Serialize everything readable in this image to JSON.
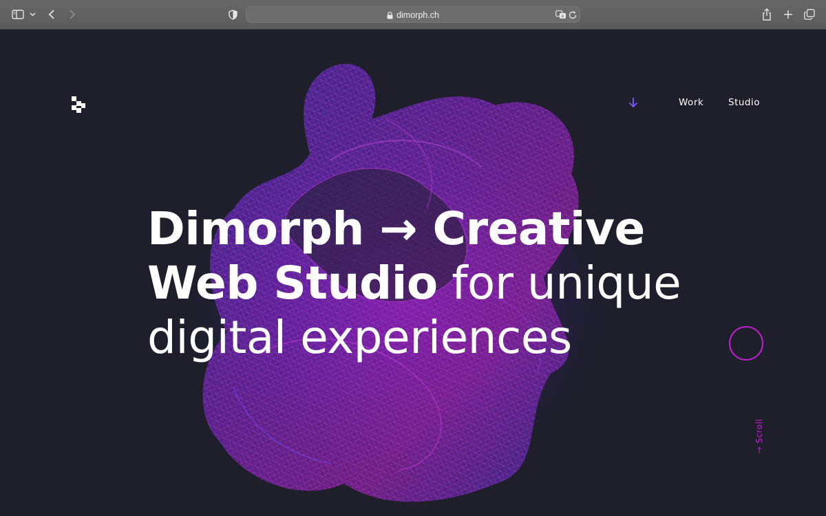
{
  "browser": {
    "url": "dimorph.ch"
  },
  "nav": {
    "links": [
      {
        "label": "Work"
      },
      {
        "label": "Studio"
      }
    ]
  },
  "hero": {
    "line1": "Dimorph → Creative",
    "line2_bold": "Web Studio",
    "line2_rest": " for unique",
    "line3": "digital experiences"
  },
  "scroll": {
    "label": "→ Scroll"
  },
  "colors": {
    "background": "#1e1f2b",
    "accent_magenta": "#c21fd3",
    "accent_violet": "#7d5cff",
    "text": "#ffffff"
  },
  "icons": {
    "sidebar": "sidebar-icon",
    "back": "chevron-left-icon",
    "forward": "chevron-right-icon",
    "privacy": "shield-icon",
    "lock": "lock-icon",
    "translate": "translate-icon",
    "reload": "reload-icon",
    "share": "share-icon",
    "new_tab": "plus-icon",
    "tabs": "tabs-overview-icon",
    "nav_arrow": "arrow-down-icon"
  }
}
